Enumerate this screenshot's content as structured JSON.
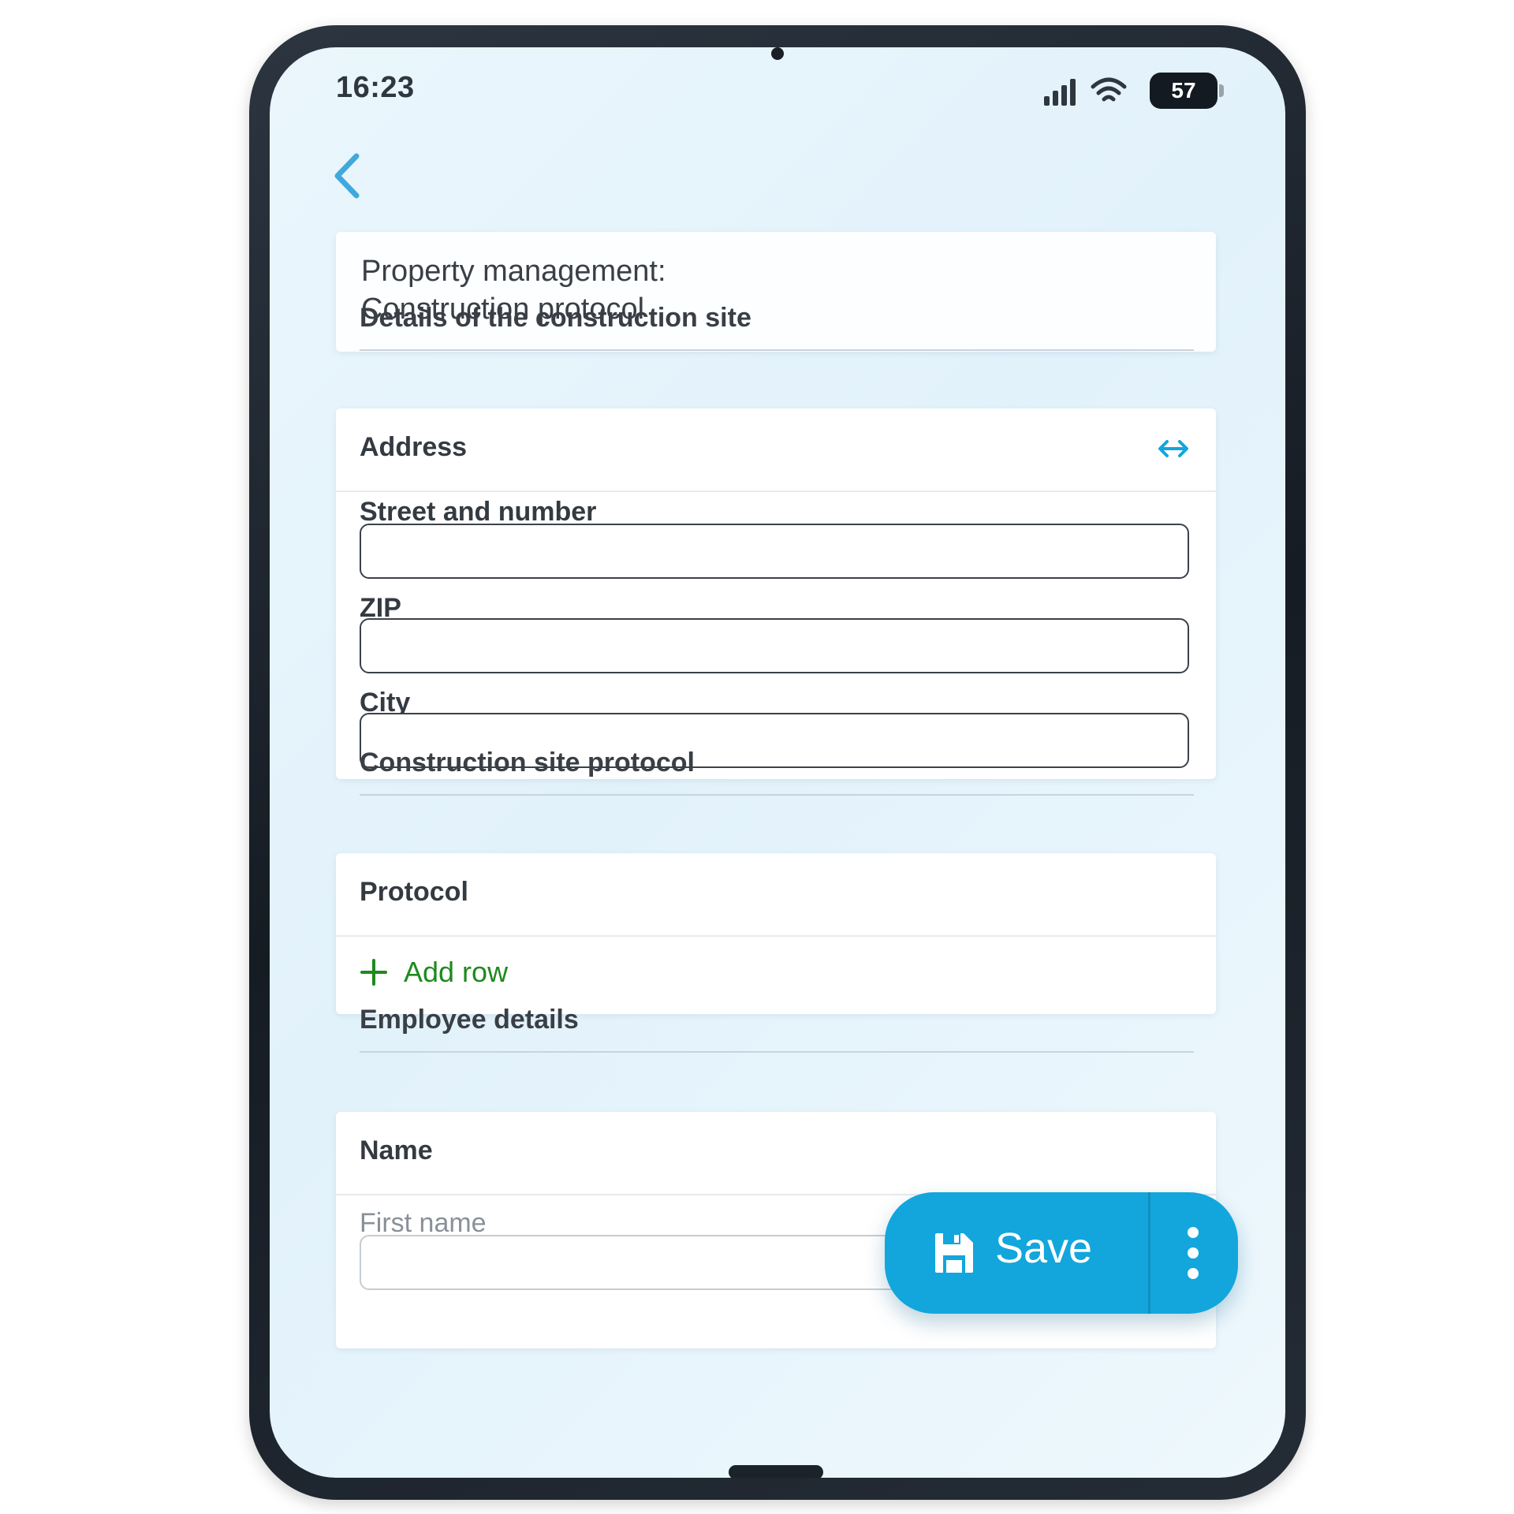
{
  "status_bar": {
    "time": "16:23",
    "battery": "57"
  },
  "header": {
    "title_line1": "Property management:",
    "title_line2": "Construction protocol"
  },
  "sections": {
    "site_details": "Details of the construction site",
    "site_protocol": "Construction site protocol",
    "employee_details": "Employee details"
  },
  "address_card": {
    "title": "Address",
    "street_label": "Street and number",
    "zip_label": "ZIP",
    "city_label": "City"
  },
  "protocol_card": {
    "title": "Protocol",
    "add_row_label": "Add row"
  },
  "name_card": {
    "title": "Name",
    "first_name_label": "First name"
  },
  "fab": {
    "save_label": "Save"
  },
  "colors": {
    "accent": "#12a6dc",
    "add_row_green": "#1e8a1e",
    "back_arrow": "#3fa9dd"
  },
  "icons": [
    "back-arrow-icon",
    "signal-icon",
    "wifi-icon",
    "expand-icon",
    "plus-icon",
    "floppy-disk-icon",
    "more-vertical-icon"
  ]
}
